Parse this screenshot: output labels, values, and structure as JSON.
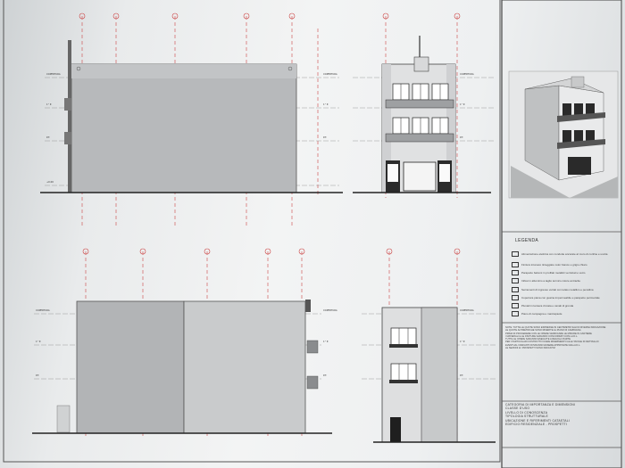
{
  "legend": {
    "title": "LEGENDA",
    "items": [
      "Alimentazione elettrica con condotte ancorate al muro di confine e uscita",
      "Finitura intonaco tinteggiato color bianco e grigio chiaro",
      "Parapetto balconi in profilati metallici verniciati e vetro",
      "Infissi in alluminio a taglio termico colore antracite",
      "Serramenti di ingresso vetrati con telaio metallico e pensilina",
      "Copertura piana con guaina impermeabile e parapetto perimetrale",
      "Pluviali in lamiera zincata e canali di gronda",
      "Piano di campagna e marciapiede"
    ]
  },
  "notes": [
    "NOTE: TUTTE LE QUOTE SONO ESPRESSE IN CENTIMETRI SALVO DIVERSA INDICAZIONE",
    "LE QUOTE ALTIMETRICHE SONO RIFERITE AL PIANO DI CAMPAGNA",
    "PRIMA DI PROCEDERE CON LE OPERE VERIFICARE LE MISURE IN CANTIERE",
    "I MATERIALI E LE FINITURE SARANNO CONCORDATI CON LA D.L.",
    "TUTTE LE OPERE SARANNO ESEGUITE A REGOLA D'ARTE",
    "PER I PARTICOLARI COSTRUTTIVI FARE RIFERIMENTO ALLE TAVOLE DI DETTAGLIO",
    "EVENTUALI VARIANTI DOVRANNO ESSERE APPROVATE DALLA D.L.",
    "LE SEZIONI E I PROSPETTI SONO INDICATIVI"
  ],
  "title_block": [
    "CATEGORIA DI IMPORTANZA E DIMENSIONI",
    "CLASSE D'USO",
    "LIVELLO DI CONOSCENZA",
    "TIPOLOGIA STRUTTURALE",
    "UBICAZIONE E RIFERIMENTI CATASTALI",
    "EDIFICIO RESIDENZIALE - PROSPETTI"
  ],
  "level_marks": {
    "coronamento": "COPERTURA",
    "primo": "1° P.",
    "terra": "P.T.",
    "quota": "+0.00"
  }
}
